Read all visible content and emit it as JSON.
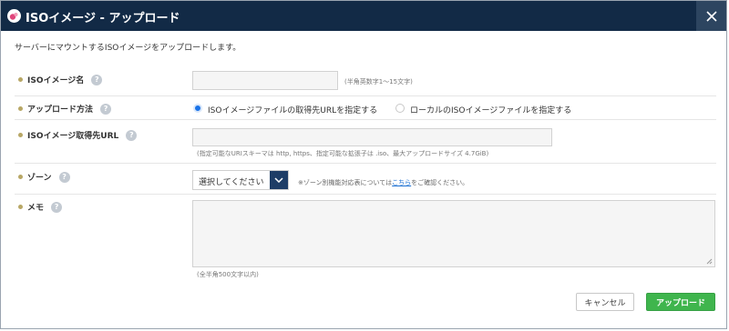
{
  "dialog": {
    "title": "ISOイメージ - アップロード",
    "close_symbol": "✕"
  },
  "intro": "サーバーにマウントするISOイメージをアップロードします。",
  "fields": {
    "name": {
      "label": "ISOイメージ名",
      "value": "",
      "hint": "(半角英数字1～15文字)"
    },
    "method": {
      "label": "アップロード方法",
      "options": [
        {
          "label": "ISOイメージファイルの取得先URLを指定する",
          "selected": true
        },
        {
          "label": "ローカルのISOイメージファイルを指定する",
          "selected": false
        }
      ]
    },
    "url": {
      "label": "ISOイメージ取得先URL",
      "value": "",
      "hint": "(指定可能なURIスキーマは http, https、指定可能な拡張子は .iso、最大アップロードサイズ 4.7GiB)"
    },
    "zone": {
      "label": "ゾーン",
      "selected": "選択してください",
      "note_before": "※ゾーン別機能対応表については",
      "note_link": "こちら",
      "note_after": "をご確認ください。"
    },
    "memo": {
      "label": "メモ",
      "value": "",
      "hint": "(全半角500文字以内)"
    }
  },
  "help_symbol": "?",
  "buttons": {
    "cancel": "キャンセル",
    "upload": "アップロード"
  },
  "colors": {
    "titlebar": "#122a46",
    "accent": "#1a73e8",
    "upload": "#3fb54d",
    "bullet": "#b8a766"
  },
  "icons": {
    "app": "app-logo-icon",
    "close": "close-icon",
    "help": "help-icon",
    "dropdown": "chevron-down-icon"
  }
}
